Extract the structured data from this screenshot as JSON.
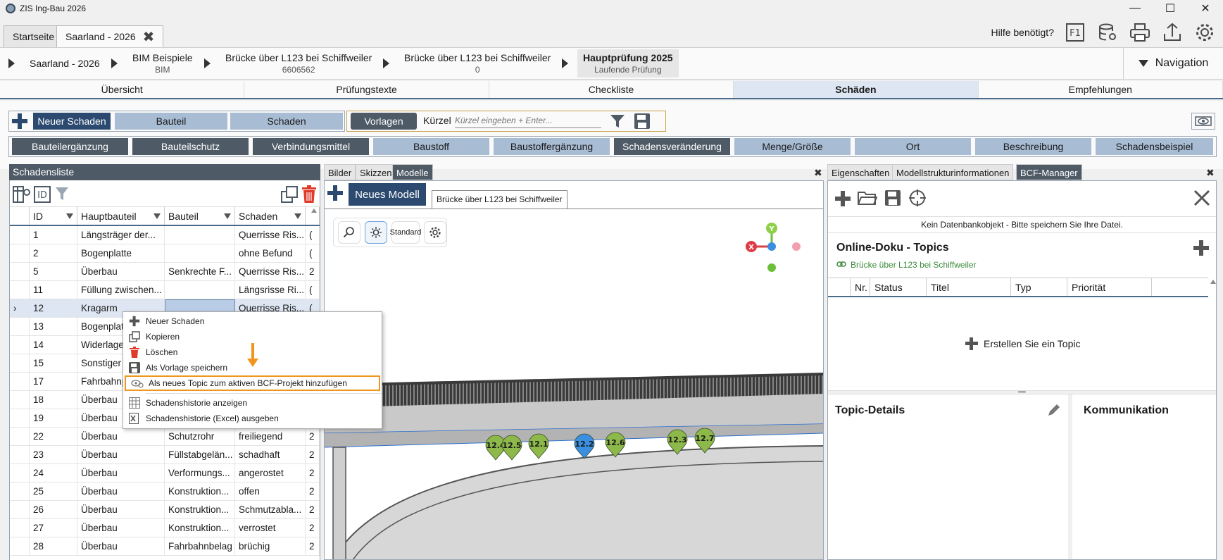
{
  "window": {
    "title": "ZIS Ing-Bau 2026"
  },
  "tabs": [
    {
      "label": "Startseite"
    },
    {
      "label": "Saarland - 2026"
    }
  ],
  "help": {
    "label": "Hilfe benötigt?",
    "f1": "F1"
  },
  "breadcrumb": [
    {
      "main": "Saarland - 2026",
      "sub": ""
    },
    {
      "main": "BIM Beispiele",
      "sub": "BIM"
    },
    {
      "main": "Brücke über L123 bei Schiffweiler",
      "sub": "6606562"
    },
    {
      "main": "Brücke über L123 bei Schiffweiler",
      "sub": "0"
    },
    {
      "main": "Hauptprüfung 2025",
      "sub": "Laufende Prüfung"
    }
  ],
  "navigation": {
    "label": "Navigation"
  },
  "main_tabs": [
    {
      "label": "Übersicht"
    },
    {
      "label": "Prüfungstexte"
    },
    {
      "label": "Checkliste"
    },
    {
      "label": "Schäden"
    },
    {
      "label": "Empfehlungen"
    }
  ],
  "toolbar": {
    "new_damage": "Neuer Schaden",
    "bauteil": "Bauteil",
    "schaden": "Schaden",
    "vorlagen": "Vorlagen",
    "kuerzel_label": "Kürzel",
    "kuerzel_placeholder": "Kürzel eingeben + Enter...",
    "row2": [
      {
        "label": "Bauteilergänzung"
      },
      {
        "label": "Bauteilschutz"
      },
      {
        "label": "Verbindungsmittel"
      },
      {
        "label": "Baustoff"
      },
      {
        "label": "Baustoffergänzung"
      },
      {
        "label": "Schadensveränderung"
      },
      {
        "label": "Menge/Größe"
      },
      {
        "label": "Ort"
      },
      {
        "label": "Beschreibung"
      },
      {
        "label": "Schadensbeispiel"
      }
    ]
  },
  "list": {
    "title": "Schadensliste",
    "columns": [
      "ID",
      "Hauptbauteil",
      "Bauteil",
      "Schaden",
      ""
    ],
    "rows": [
      {
        "id": "1",
        "haupt": "Längsträger der...",
        "bauteil": "",
        "schaden": "Querrisse Ris...",
        "x": "("
      },
      {
        "id": "2",
        "haupt": "Bogenplatte",
        "bauteil": "",
        "schaden": "ohne Befund",
        "x": "("
      },
      {
        "id": "5",
        "haupt": "Überbau",
        "bauteil": "Senkrechte F...",
        "schaden": "Querrisse Ris...",
        "x": "2"
      },
      {
        "id": "11",
        "haupt": "Füllung zwischen...",
        "bauteil": "",
        "schaden": "Längsrisse Ri...",
        "x": "("
      },
      {
        "id": "12",
        "haupt": "Kragarm",
        "bauteil": "",
        "schaden": "Querrisse Ris...",
        "x": "("
      },
      {
        "id": "13",
        "haupt": "Bogenplat",
        "bauteil": "",
        "schaden": "",
        "x": ""
      },
      {
        "id": "14",
        "haupt": "Widerlage",
        "bauteil": "",
        "schaden": "",
        "x": ""
      },
      {
        "id": "15",
        "haupt": "Sonstiger",
        "bauteil": "",
        "schaden": "",
        "x": ""
      },
      {
        "id": "17",
        "haupt": "Fahrbahnp",
        "bauteil": "",
        "schaden": "",
        "x": ""
      },
      {
        "id": "18",
        "haupt": "Überbau",
        "bauteil": "",
        "schaden": "",
        "x": ""
      },
      {
        "id": "19",
        "haupt": "Überbau",
        "bauteil": "",
        "schaden": "",
        "x": ""
      },
      {
        "id": "22",
        "haupt": "Überbau",
        "bauteil": "Schutzrohr",
        "schaden": "freiliegend",
        "x": "2"
      },
      {
        "id": "23",
        "haupt": "Überbau",
        "bauteil": "Füllstabgelän...",
        "schaden": "schadhaft",
        "x": "2"
      },
      {
        "id": "24",
        "haupt": "Überbau",
        "bauteil": "Verformungs...",
        "schaden": "angerostet",
        "x": "2"
      },
      {
        "id": "25",
        "haupt": "Überbau",
        "bauteil": "Konstruktion...",
        "schaden": "offen",
        "x": "2"
      },
      {
        "id": "26",
        "haupt": "Überbau",
        "bauteil": "Konstruktion...",
        "schaden": "Schmutzabla...",
        "x": "2"
      },
      {
        "id": "27",
        "haupt": "Überbau",
        "bauteil": "Konstruktion...",
        "schaden": "verrostet",
        "x": "2"
      },
      {
        "id": "28",
        "haupt": "Überbau",
        "bauteil": "Fahrbahnbelag",
        "schaden": "brüchig",
        "x": "2"
      }
    ]
  },
  "context_menu": [
    {
      "label": "Neuer Schaden",
      "icon": "plus-icon"
    },
    {
      "label": "Kopieren",
      "icon": "copy-icon"
    },
    {
      "label": "Löschen",
      "icon": "trash-icon"
    },
    {
      "label": "Als Vorlage speichern",
      "icon": "save-icon"
    },
    {
      "label": "Als neues Topic zum aktiven BCF-Projekt hinzufügen",
      "icon": "bcf-icon"
    },
    {
      "label": "Schadenshistorie anzeigen",
      "icon": "table-icon"
    },
    {
      "label": "Schadenshistorie (Excel) ausgeben",
      "icon": "excel-icon"
    }
  ],
  "center_tabs": [
    {
      "label": "Bilder"
    },
    {
      "label": "Skizzen"
    },
    {
      "label": "Modelle"
    }
  ],
  "viewer": {
    "new_model": "Neues Modell",
    "model_tab": "Brücke über L123 bei Schiffweiler",
    "standard": "Standard",
    "markers": [
      {
        "label": "12.4",
        "color": "#8db84a"
      },
      {
        "label": "12.5",
        "color": "#8db84a"
      },
      {
        "label": "12.1",
        "color": "#8db84a"
      },
      {
        "label": "12.2",
        "color": "#3a8fe0"
      },
      {
        "label": "12.6",
        "color": "#8db84a"
      },
      {
        "label": "12.3",
        "color": "#8db84a"
      },
      {
        "label": "12.7",
        "color": "#8db84a"
      }
    ],
    "axes": {
      "x": "X",
      "y": "Y"
    }
  },
  "right_tabs": [
    {
      "label": "Eigenschaften"
    },
    {
      "label": "Modellstrukturinformationen"
    },
    {
      "label": "BCF-Manager"
    }
  ],
  "bcf": {
    "notice": "Kein Datenbankobjekt - Bitte speichern Sie Ihre Datei.",
    "topics_title": "Online-Doku - Topics",
    "project_link": "Brücke über L123 bei Schiffweiler",
    "columns": [
      "Nr.",
      "Status",
      "Titel",
      "Typ",
      "Priorität"
    ],
    "create_topic": "Erstellen Sie ein Topic",
    "details_title": "Topic-Details",
    "communication_title": "Kommunikation"
  },
  "colors": {
    "accent": "#2c4a70",
    "header": "#4e5a66",
    "light_button": "#a8bcd4",
    "highlight": "#f0961e"
  }
}
